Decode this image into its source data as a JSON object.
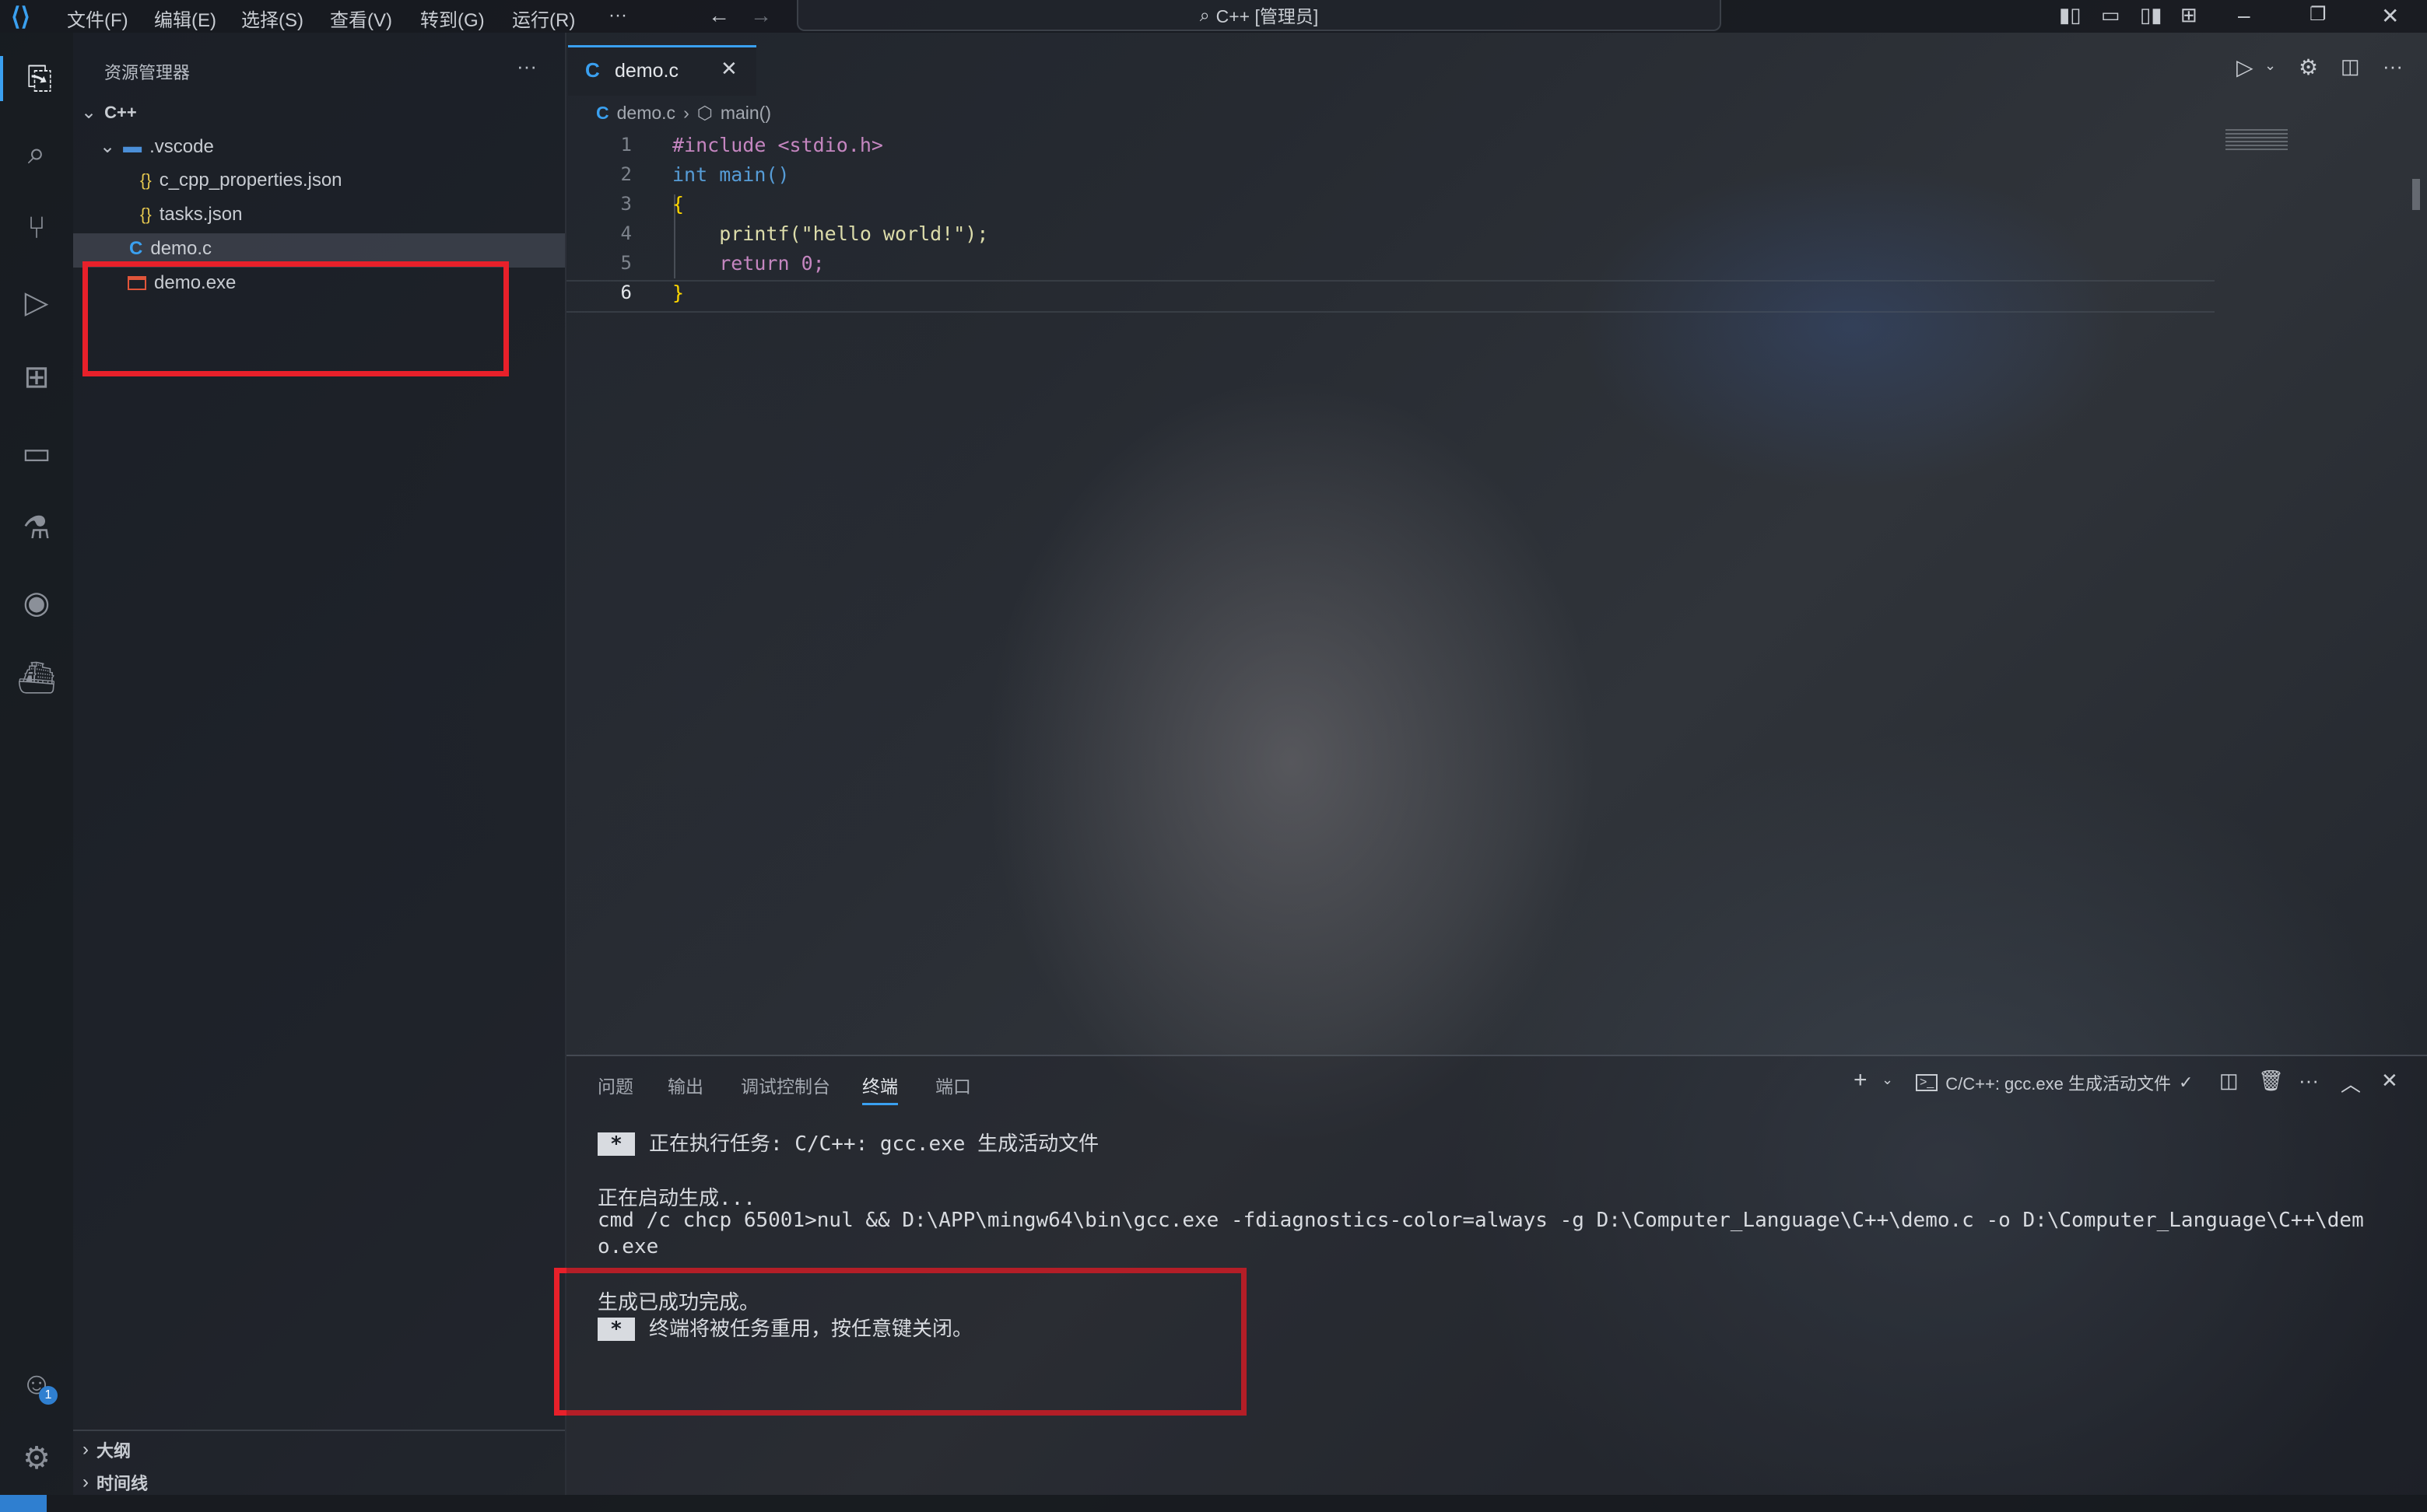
{
  "titlebar": {
    "menus": [
      "文件(F)",
      "编辑(E)",
      "选择(S)",
      "查看(V)",
      "转到(G)",
      "运行(R)",
      "···"
    ],
    "command_center": "C++ [管理员]"
  },
  "sidebar": {
    "title": "资源管理器",
    "more": "···",
    "root": "C++",
    "folder": ".vscode",
    "files": [
      "c_cpp_properties.json",
      "tasks.json"
    ],
    "demo_c": "demo.c",
    "demo_exe": "demo.exe",
    "outline": "大纲",
    "timeline": "时间线"
  },
  "editor": {
    "tab": "demo.c",
    "breadcrumb_file": "demo.c",
    "breadcrumb_symbol": "main()",
    "lines": [
      {
        "n": "1",
        "code": "#include <stdio.h>"
      },
      {
        "n": "2",
        "code": "int main()"
      },
      {
        "n": "3",
        "code": "{"
      },
      {
        "n": "4",
        "code": "    printf(\"hello world!\");"
      },
      {
        "n": "5",
        "code": "    return 0;"
      },
      {
        "n": "6",
        "code": "}"
      }
    ]
  },
  "panel": {
    "tabs": [
      "问题",
      "输出",
      "调试控制台",
      "终端",
      "端口"
    ],
    "active_tab": "终端",
    "terminal_name": "C/C++: gcc.exe 生成活动文件",
    "lines": {
      "task": "正在执行任务: C/C++: gcc.exe 生成活动文件",
      "starting": "正在启动生成...",
      "cmd1": "cmd /c chcp 65001>nul && D:\\APP\\mingw64\\bin\\gcc.exe -fdiagnostics-color=always -g D:\\Computer_Language\\C++\\demo.c -o D:\\Computer_Language\\C++\\dem",
      "cmd2": "o.exe",
      "success": "生成已成功完成。",
      "reuse": "终端将被任务重用，按任意键关闭。"
    },
    "star": "*"
  },
  "badges": {
    "accounts": "1"
  },
  "colors": {
    "highlight_box": "#e8202a",
    "keyword": "#569cd6",
    "string": "#ce9178",
    "preprocessor": "#c586c0",
    "number": "#b5cea8",
    "function": "#dcdcaa",
    "brace": "#ffd700"
  }
}
